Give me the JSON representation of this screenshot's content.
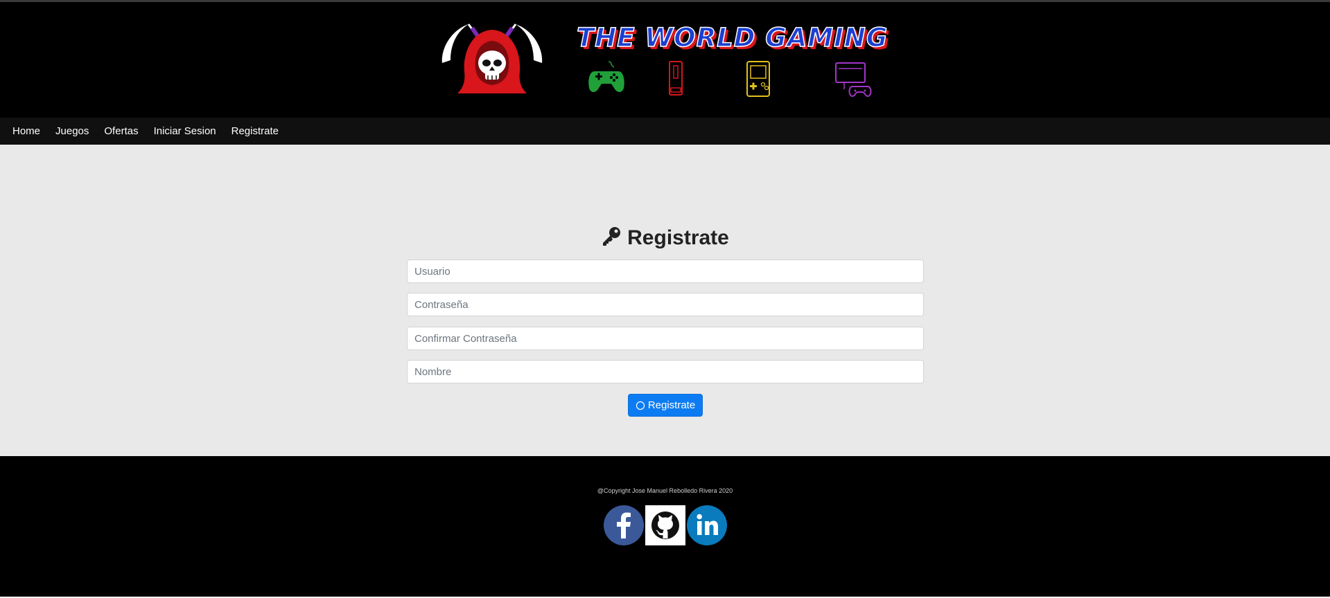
{
  "header": {
    "brand_title": "THE WORLD GAMING",
    "logo_icon": "hooded-skull-reaper-icon",
    "console_icons": [
      "gamepad-icon",
      "wii-console-icon",
      "gameboy-icon",
      "pc-console-icon"
    ],
    "colors": {
      "brand_blue": "#1b3fd0",
      "brand_red": "#d8161b"
    }
  },
  "nav": {
    "items": [
      {
        "label": "Home"
      },
      {
        "label": "Juegos"
      },
      {
        "label": "Ofertas"
      },
      {
        "label": "Iniciar Sesion"
      },
      {
        "label": "Registrate"
      }
    ]
  },
  "form": {
    "title": "Registrate",
    "title_icon": "key-icon",
    "fields": [
      {
        "placeholder": "Usuario",
        "value": ""
      },
      {
        "placeholder": "Contraseña",
        "value": ""
      },
      {
        "placeholder": "Confirmar Contraseña",
        "value": ""
      },
      {
        "placeholder": "Nombre",
        "value": ""
      }
    ],
    "submit_label": "Registrate",
    "submit_icon": "circle-icon",
    "accent_color": "#0d7cf2"
  },
  "footer": {
    "copyright": "@Copyright Jose Manuel Rebolledo Rivera 2020",
    "social": [
      "facebook-icon",
      "github-icon",
      "linkedin-icon"
    ]
  }
}
